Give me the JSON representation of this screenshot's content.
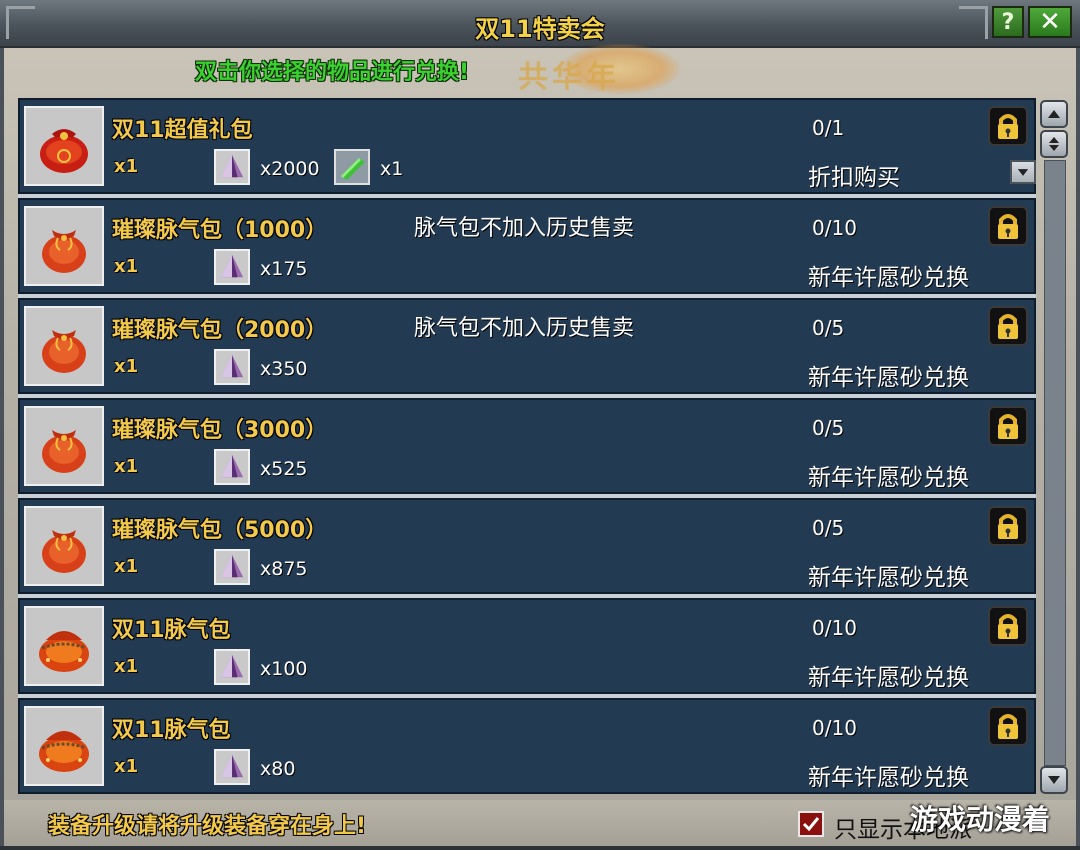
{
  "window": {
    "title": "双11特卖会",
    "help_label": "?",
    "close_label": "✕"
  },
  "hint_text": "双击你选择的物品进行兑换!",
  "decoration_text": "共华年",
  "rows": [
    {
      "name": "双11超值礼包",
      "icon": "gift-bag-icon",
      "qty": "x1",
      "costs": [
        "x2000",
        "x1"
      ],
      "cost_icons": [
        "crystal-icon",
        "jade-token-icon"
      ],
      "note": "",
      "limit": "0/1",
      "method": "折扣购买",
      "has_dropdown": true
    },
    {
      "name": "璀璨脉气包（1000）",
      "icon": "pouch-icon",
      "qty": "x1",
      "costs": [
        "x175"
      ],
      "cost_icons": [
        "crystal-icon"
      ],
      "note": "脉气包不加入历史售卖",
      "limit": "0/10",
      "method": "新年许愿砂兑换"
    },
    {
      "name": "璀璨脉气包（2000）",
      "icon": "pouch-icon",
      "qty": "x1",
      "costs": [
        "x350"
      ],
      "cost_icons": [
        "crystal-icon"
      ],
      "note": "脉气包不加入历史售卖",
      "limit": "0/5",
      "method": "新年许愿砂兑换"
    },
    {
      "name": "璀璨脉气包（3000）",
      "icon": "pouch-icon",
      "qty": "x1",
      "costs": [
        "x525"
      ],
      "cost_icons": [
        "crystal-icon"
      ],
      "note": "",
      "limit": "0/5",
      "method": "新年许愿砂兑换"
    },
    {
      "name": "璀璨脉气包（5000）",
      "icon": "pouch-icon",
      "qty": "x1",
      "costs": [
        "x875"
      ],
      "cost_icons": [
        "crystal-icon"
      ],
      "note": "",
      "limit": "0/5",
      "method": "新年许愿砂兑换"
    },
    {
      "name": "双11脉气包",
      "icon": "beaded-pouch-icon",
      "qty": "x1",
      "costs": [
        "x100"
      ],
      "cost_icons": [
        "crystal-icon"
      ],
      "note": "",
      "limit": "0/10",
      "method": "新年许愿砂兑换"
    },
    {
      "name": "双11脉气包",
      "icon": "beaded-pouch-icon",
      "qty": "x1",
      "costs": [
        "x80"
      ],
      "cost_icons": [
        "crystal-icon"
      ],
      "note": "",
      "limit": "0/10",
      "method": "新年许愿砂兑换"
    }
  ],
  "footer": {
    "note": "装备升级请将升级装备穿在身上!",
    "checkbox_label": "只显示本地派",
    "checkbox_checked": true
  },
  "watermark": "游戏动漫着",
  "colors": {
    "row_bg": "#233a53",
    "gold_text": "#f2c94c",
    "hint_green": "#3bd12f",
    "title_gold": "#f3d24a"
  }
}
